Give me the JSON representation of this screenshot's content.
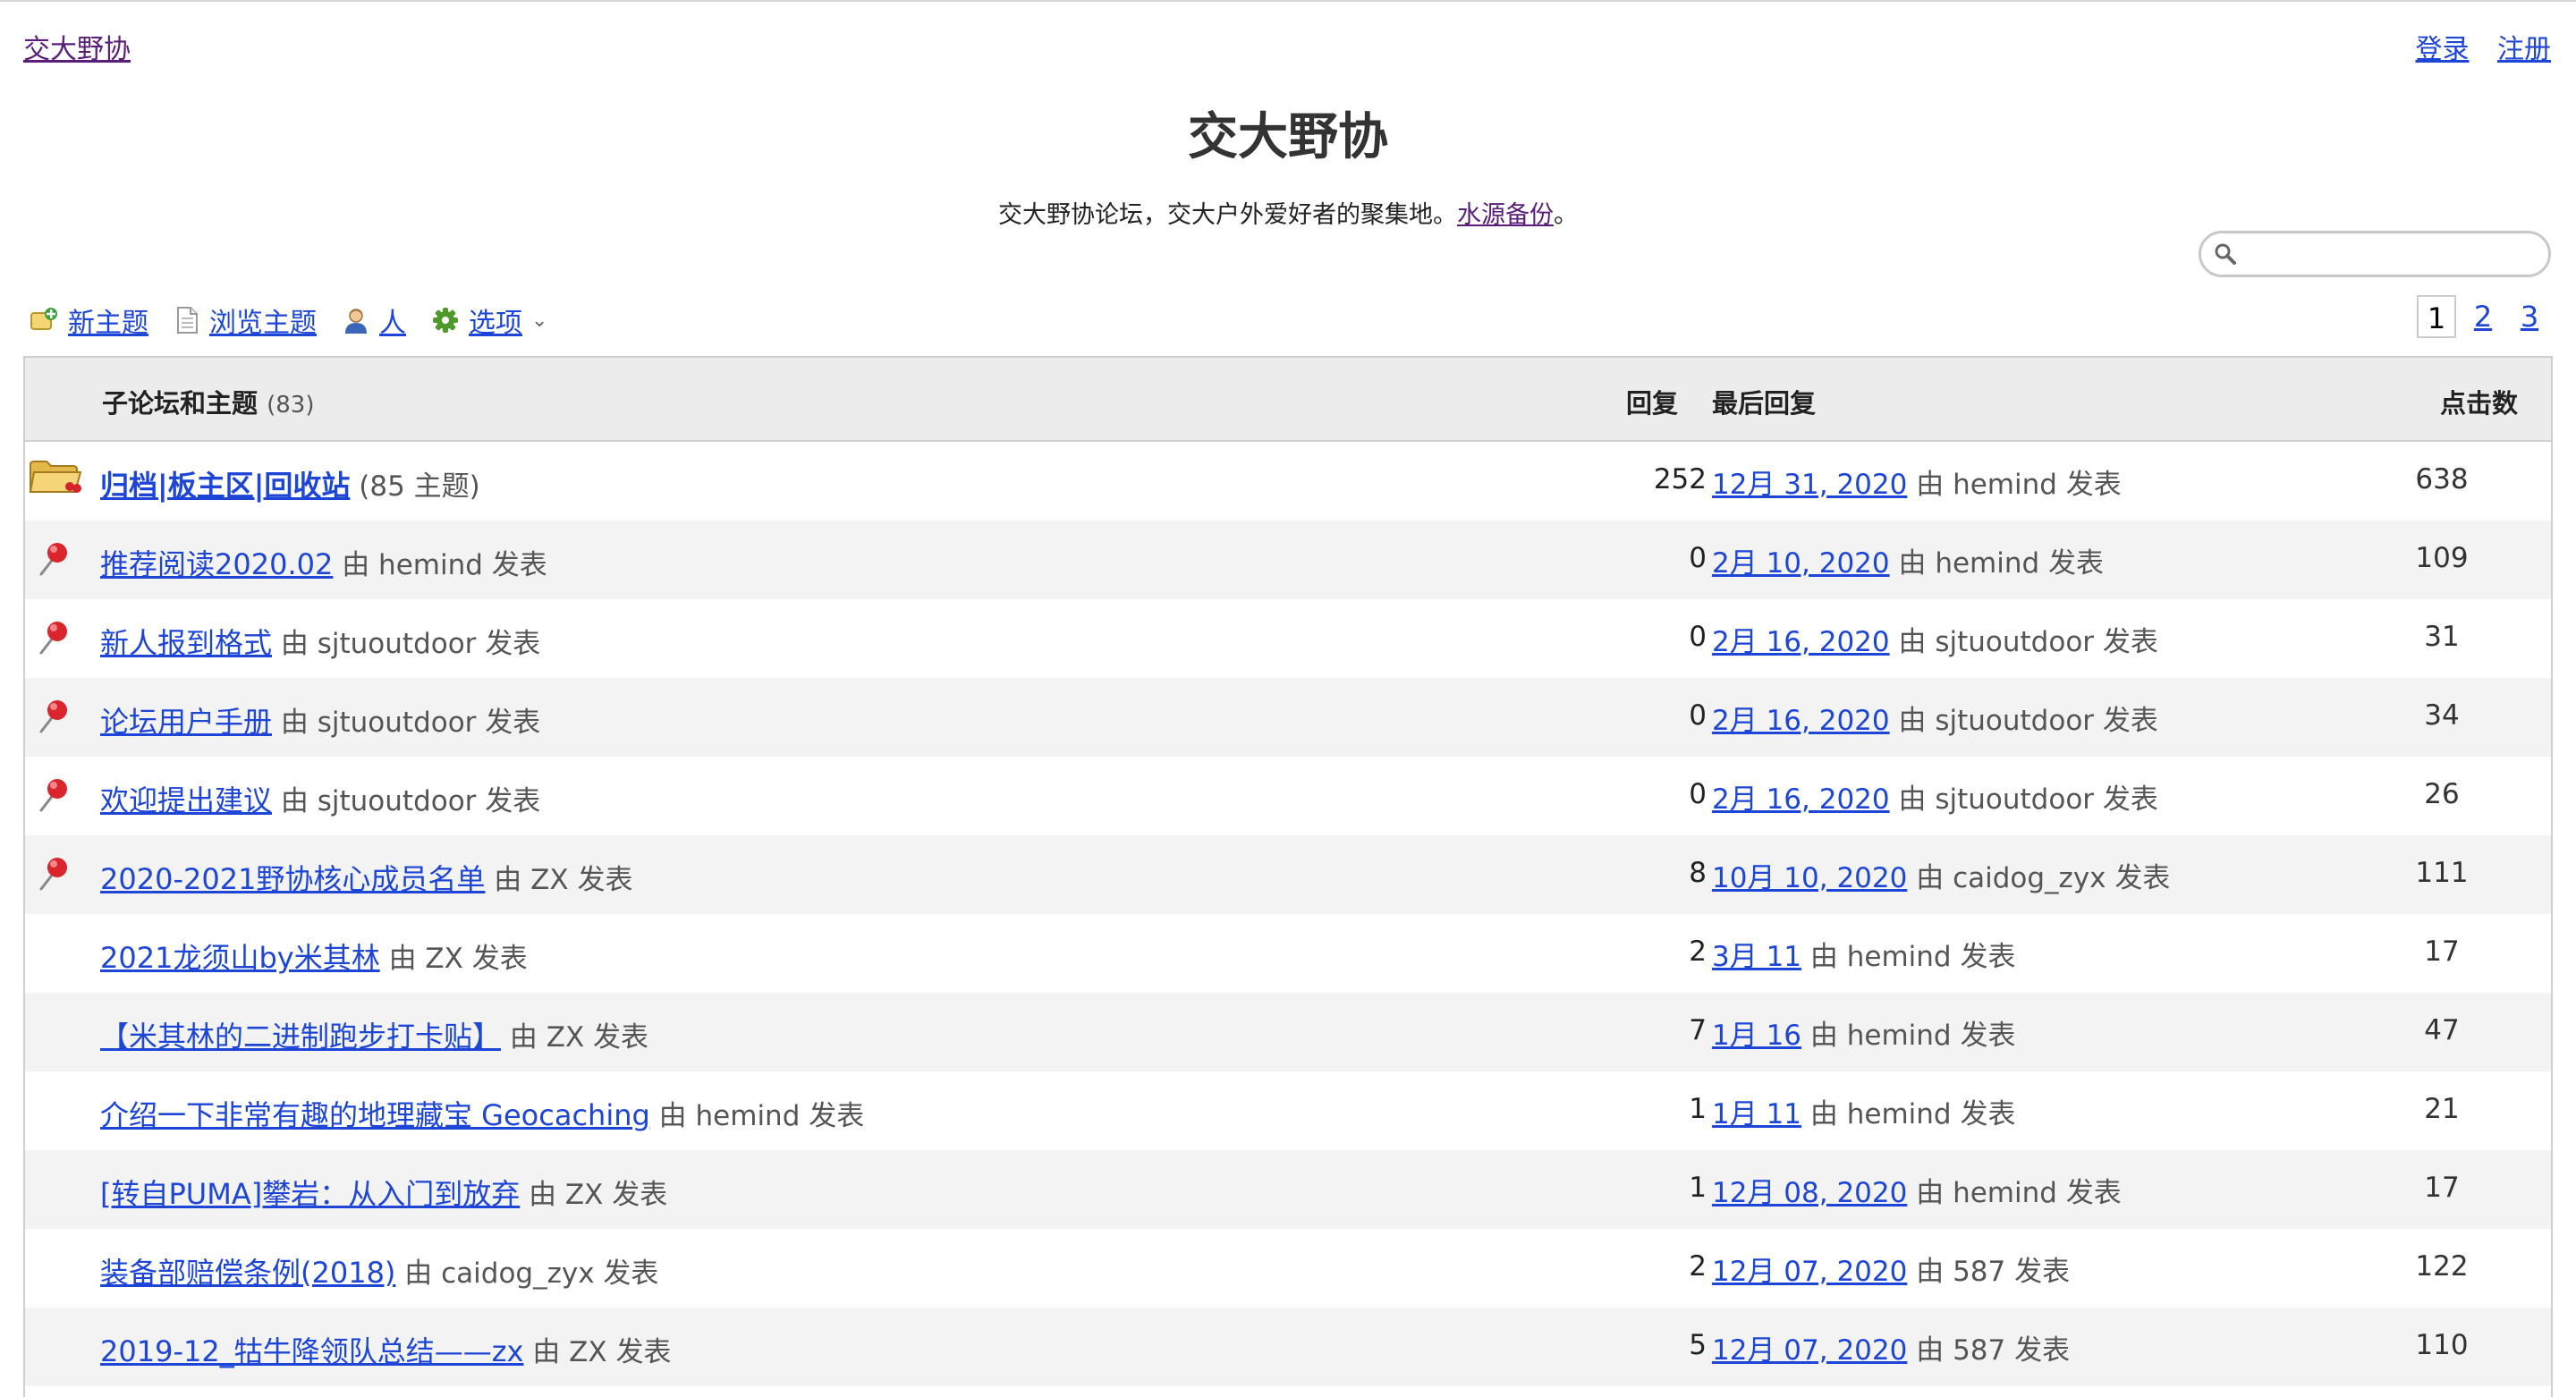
{
  "site": {
    "name": "交大野协",
    "title": "交大野协",
    "description_prefix": "交大野协论坛，交大户外爱好者的聚集地。",
    "description_link": "水源备份",
    "description_suffix": "。"
  },
  "auth": {
    "login": "登录",
    "register": "注册"
  },
  "search": {
    "placeholder": ""
  },
  "toolbar": {
    "new_topic": "新主题",
    "browse": "浏览主题",
    "people": "人",
    "options": "选项"
  },
  "pager": {
    "pages": [
      "1",
      "2",
      "3"
    ],
    "current": "1"
  },
  "table": {
    "col_topics": "子论坛和主题",
    "topic_count": "(83)",
    "col_replies": "回复",
    "col_last": "最后回复",
    "col_views": "点击数",
    "rows": [
      {
        "icon": "folder",
        "title": "归档|板主区|回收站",
        "suffix": "(85 主题)",
        "replies": "252",
        "last_date": "12月 31, 2020",
        "last_by": "由 hemind 发表",
        "views": "638"
      },
      {
        "icon": "pin",
        "title": "推荐阅读2020.02",
        "suffix": "由 hemind 发表",
        "replies": "0",
        "last_date": "2月 10, 2020",
        "last_by": "由 hemind 发表",
        "views": "109"
      },
      {
        "icon": "pin",
        "title": "新人报到格式",
        "suffix": "由 sjtuoutdoor 发表",
        "replies": "0",
        "last_date": "2月 16, 2020",
        "last_by": "由 sjtuoutdoor 发表",
        "views": "31"
      },
      {
        "icon": "pin",
        "title": "论坛用户手册",
        "suffix": "由 sjtuoutdoor 发表",
        "replies": "0",
        "last_date": "2月 16, 2020",
        "last_by": "由 sjtuoutdoor 发表",
        "views": "34"
      },
      {
        "icon": "pin",
        "title": "欢迎提出建议",
        "suffix": "由 sjtuoutdoor 发表",
        "replies": "0",
        "last_date": "2月 16, 2020",
        "last_by": "由 sjtuoutdoor 发表",
        "views": "26"
      },
      {
        "icon": "pin",
        "title": "2020-2021野协核心成员名单",
        "suffix": "由 ZX 发表",
        "replies": "8",
        "last_date": "10月 10, 2020",
        "last_by": "由 caidog_zyx 发表",
        "views": "111"
      },
      {
        "icon": "",
        "title": "2021龙须山by米其林",
        "suffix": "由 ZX 发表",
        "replies": "2",
        "last_date": "3月 11",
        "last_by": "由 hemind 发表",
        "views": "17"
      },
      {
        "icon": "",
        "title": "【米其林的二进制跑步打卡贴】",
        "suffix": "由 ZX 发表",
        "replies": "7",
        "last_date": "1月 16",
        "last_by": "由 hemind 发表",
        "views": "47"
      },
      {
        "icon": "",
        "title": "介绍一下非常有趣的地理藏宝 Geocaching",
        "suffix": "由 hemind 发表",
        "replies": "1",
        "last_date": "1月 11",
        "last_by": "由 hemind 发表",
        "views": "21"
      },
      {
        "icon": "",
        "title": "[转自PUMA]攀岩：从入门到放弃",
        "suffix": "由 ZX 发表",
        "replies": "1",
        "last_date": "12月 08, 2020",
        "last_by": "由 hemind 发表",
        "views": "17"
      },
      {
        "icon": "",
        "title": "装备部赔偿条例(2018)",
        "suffix": "由 caidog_zyx 发表",
        "replies": "2",
        "last_date": "12月 07, 2020",
        "last_by": "由 587 发表",
        "views": "122"
      },
      {
        "icon": "",
        "title": "2019-12_牯牛降领队总结——zx",
        "suffix": "由 ZX 发表",
        "replies": "5",
        "last_date": "12月 07, 2020",
        "last_by": "由 587 发表",
        "views": "110"
      }
    ]
  }
}
